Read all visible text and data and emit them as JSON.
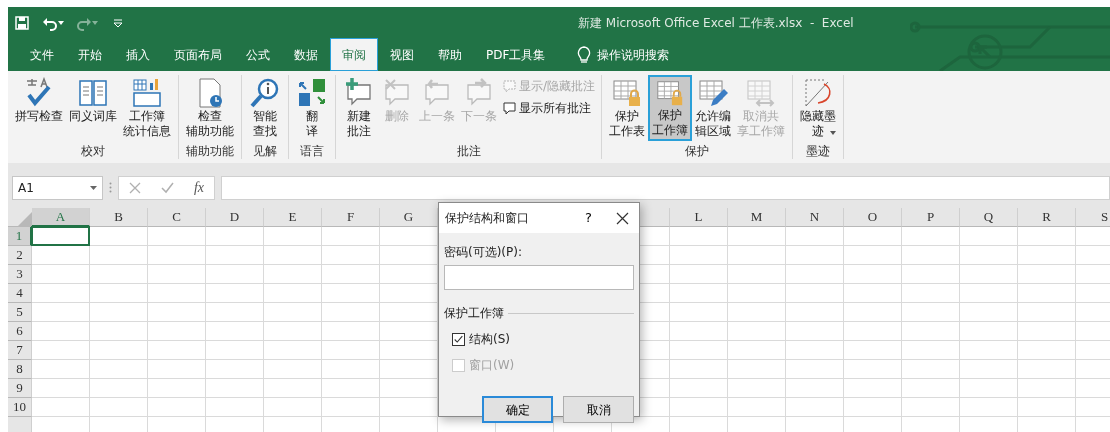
{
  "window": {
    "title": "新建 Microsoft Office Excel 工作表.xlsx  -  Excel"
  },
  "quick_access": [
    {
      "kind": "save",
      "disabled": false
    },
    {
      "kind": "undo",
      "disabled": false
    },
    {
      "kind": "redo",
      "disabled": true
    },
    {
      "kind": "customize",
      "disabled": false
    }
  ],
  "tabs": [
    {
      "label": "文件",
      "selected": false
    },
    {
      "label": "开始",
      "selected": false
    },
    {
      "label": "插入",
      "selected": false
    },
    {
      "label": "页面布局",
      "selected": false
    },
    {
      "label": "公式",
      "selected": false
    },
    {
      "label": "数据",
      "selected": false
    },
    {
      "label": "审阅",
      "selected": true
    },
    {
      "label": "视图",
      "selected": false
    },
    {
      "label": "帮助",
      "selected": false
    },
    {
      "label": "PDF工具集",
      "selected": false
    }
  ],
  "tell_me": {
    "label": "操作说明搜索"
  },
  "ribbon": {
    "groups": [
      {
        "label": "校对",
        "buttons": [
          {
            "kind": "large",
            "lines": [
              "拼写检查"
            ],
            "disabled": false,
            "selected": false,
            "dropdown": false
          },
          {
            "kind": "large",
            "lines": [
              "同义词库"
            ],
            "disabled": false,
            "selected": false,
            "dropdown": false
          },
          {
            "kind": "large",
            "lines": [
              "工作簿",
              "统计信息"
            ],
            "disabled": false,
            "selected": false,
            "dropdown": false
          }
        ]
      },
      {
        "label": "辅助功能",
        "buttons": [
          {
            "kind": "large",
            "lines": [
              "检查",
              "辅助功能"
            ],
            "disabled": false,
            "selected": false,
            "dropdown": false
          }
        ]
      },
      {
        "label": "见解",
        "buttons": [
          {
            "kind": "large",
            "lines": [
              "智能",
              "查找"
            ],
            "disabled": false,
            "selected": false,
            "dropdown": false
          }
        ]
      },
      {
        "label": "语言",
        "buttons": [
          {
            "kind": "large",
            "lines": [
              "翻",
              "译"
            ],
            "disabled": false,
            "selected": false,
            "dropdown": false
          }
        ]
      },
      {
        "label": "批注",
        "buttons": [
          {
            "kind": "large",
            "lines": [
              "新建",
              "批注"
            ],
            "disabled": false,
            "selected": false,
            "dropdown": false
          },
          {
            "kind": "large",
            "lines": [
              "删除"
            ],
            "disabled": true,
            "selected": false,
            "dropdown": false
          },
          {
            "kind": "large",
            "lines": [
              "上一条"
            ],
            "disabled": true,
            "selected": false,
            "dropdown": false
          },
          {
            "kind": "large",
            "lines": [
              "下一条"
            ],
            "disabled": true,
            "selected": false,
            "dropdown": false
          },
          {
            "kind": "small",
            "lines": [
              "显示/隐藏批注"
            ],
            "disabled": true
          },
          {
            "kind": "small",
            "lines": [
              "显示所有批注"
            ],
            "disabled": false
          }
        ]
      },
      {
        "label": "保护",
        "buttons": [
          {
            "kind": "large",
            "lines": [
              "保护",
              "工作表"
            ],
            "disabled": false,
            "selected": false,
            "dropdown": false
          },
          {
            "kind": "large",
            "lines": [
              "保护",
              "工作簿"
            ],
            "disabled": false,
            "selected": true,
            "dropdown": false
          },
          {
            "kind": "large",
            "lines": [
              "允许编",
              "辑区域"
            ],
            "disabled": false,
            "selected": false,
            "dropdown": false
          },
          {
            "kind": "large",
            "lines": [
              "取消共",
              "享工作簿"
            ],
            "disabled": true,
            "selected": false,
            "dropdown": false
          }
        ]
      },
      {
        "label": "墨迹",
        "buttons": [
          {
            "kind": "large",
            "lines": [
              "隐藏墨",
              "迹"
            ],
            "disabled": false,
            "selected": false,
            "dropdown": true
          }
        ]
      }
    ]
  },
  "formula_bar": {
    "name_box": "A1",
    "buttons": [
      {
        "kind": "cancel",
        "disabled": true
      },
      {
        "kind": "enter",
        "disabled": true
      },
      {
        "kind": "function",
        "label": "fx",
        "disabled": false
      }
    ]
  },
  "sheet": {
    "columns": [
      {
        "label": "A",
        "selected": true
      },
      {
        "label": "B",
        "selected": false
      },
      {
        "label": "C",
        "selected": false
      },
      {
        "label": "D",
        "selected": false
      },
      {
        "label": "E",
        "selected": false
      },
      {
        "label": "F",
        "selected": false
      },
      {
        "label": "G",
        "selected": false
      },
      {},
      {},
      {},
      {
        "selected": false
      },
      {
        "label": "L",
        "selected": false
      },
      {
        "label": "M",
        "selected": false
      },
      {
        "label": "N",
        "selected": false
      },
      {
        "label": "O",
        "selected": false
      },
      {
        "label": "P",
        "selected": false
      },
      {
        "label": "Q",
        "selected": false
      },
      {
        "label": "R",
        "selected": false
      },
      {
        "label": "S",
        "selected": false
      }
    ],
    "rows": [
      {
        "label": "1",
        "selected": true
      },
      {
        "label": "2",
        "selected": false
      },
      {
        "label": "3",
        "selected": false
      },
      {
        "label": "4",
        "selected": false
      },
      {
        "label": "5",
        "selected": false
      },
      {
        "label": "6",
        "selected": false
      },
      {
        "label": "7",
        "selected": false
      },
      {
        "label": "8",
        "selected": false
      },
      {
        "label": "9",
        "selected": false
      },
      {
        "label": "10",
        "selected": false
      }
    ]
  },
  "dialog": {
    "title": "保护结构和窗口",
    "help": "?",
    "password_label": "密码(可选)(P):",
    "group_label": "保护工作簿",
    "options": [
      {
        "label": "结构(S)",
        "checked": true,
        "disabled": false
      },
      {
        "label": "窗口(W)",
        "checked": false,
        "disabled": true
      }
    ],
    "buttons": [
      {
        "label": "确定",
        "default": true
      },
      {
        "label": "取消",
        "default": false
      }
    ]
  }
}
